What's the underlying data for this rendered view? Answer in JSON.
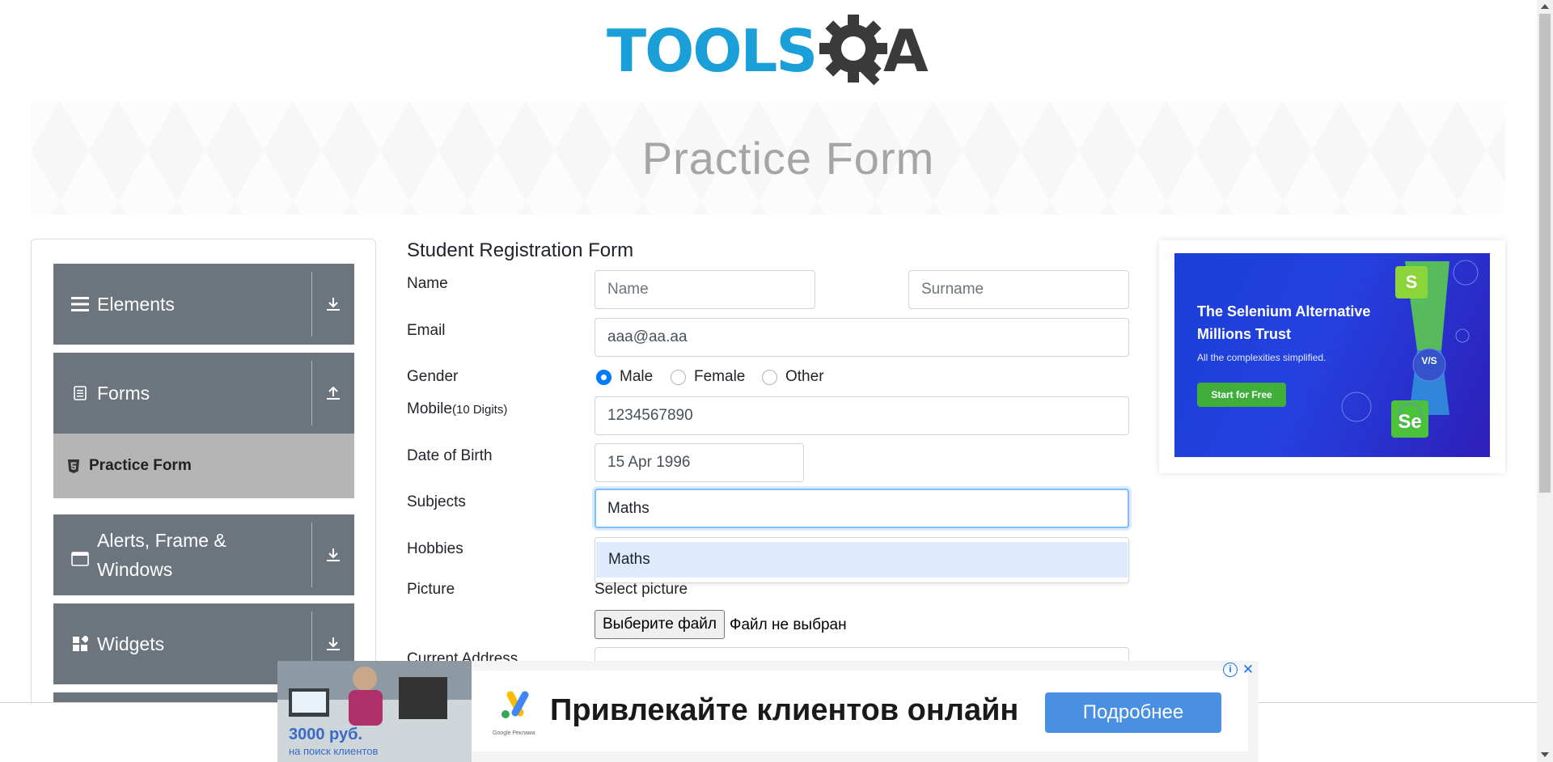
{
  "header": {
    "logo_text": "TOOLSQA"
  },
  "banner": {
    "title": "Practice Form"
  },
  "sidebar": {
    "groups": [
      {
        "label": "Elements",
        "icon": "menu-lines-icon",
        "arrow": "download-arrow-icon"
      },
      {
        "label": "Forms",
        "icon": "document-icon",
        "arrow": "upload-arrow-icon"
      },
      {
        "label": "Alerts, Frame & Windows",
        "icon": "window-icon",
        "arrow": "download-arrow-icon"
      },
      {
        "label": "Widgets",
        "icon": "widgets-icon",
        "arrow": "download-arrow-icon"
      }
    ],
    "active_item": {
      "label": "Practice Form",
      "icon": "html5-icon"
    }
  },
  "form": {
    "title": "Student Registration Form",
    "labels": {
      "name": "Name",
      "email": "Email",
      "gender": "Gender",
      "mobile": "Mobile",
      "mobile_hint": "(10 Digits)",
      "dob": "Date of Birth",
      "subjects": "Subjects",
      "hobbies": "Hobbies",
      "picture": "Picture",
      "address": "Current Address"
    },
    "first_name_placeholder": "Name",
    "last_name_placeholder": "Surname",
    "email_value": "aaa@aa.aa",
    "gender_options": [
      "Male",
      "Female",
      "Other"
    ],
    "gender_selected": "Male",
    "mobile_value": "1234567890",
    "dob_value": "15 Apr 1996",
    "subjects_value": "Maths",
    "subjects_suggestion": "Maths",
    "picture_label": "Select picture",
    "file_button": "Выберите файл",
    "file_status": "Файл не выбран"
  },
  "right_ad": {
    "headline": "The Selenium Alternative Millions Trust",
    "subline": "All the complexities simplified.",
    "cta": "Start for Free",
    "vs_badge": "V/S",
    "badge_s": "S",
    "badge_se": "Se"
  },
  "bottom_ad": {
    "price": "3000 руб.",
    "price_sub": "на поиск клиентов",
    "headline": "Привлекайте клиентов онлайн",
    "button": "Подробнее",
    "brand": "Google Реклама"
  },
  "colors": {
    "brand_blue": "#1a9fd8",
    "brand_dark": "#3a3a3a",
    "sidebar_group": "#6c757d",
    "sidebar_active": "#b5b5b5",
    "focus_border": "#80bdff",
    "radio_selected": "#007bff",
    "suggestion_bg": "#deebff",
    "ad_button": "#4a90e2"
  }
}
